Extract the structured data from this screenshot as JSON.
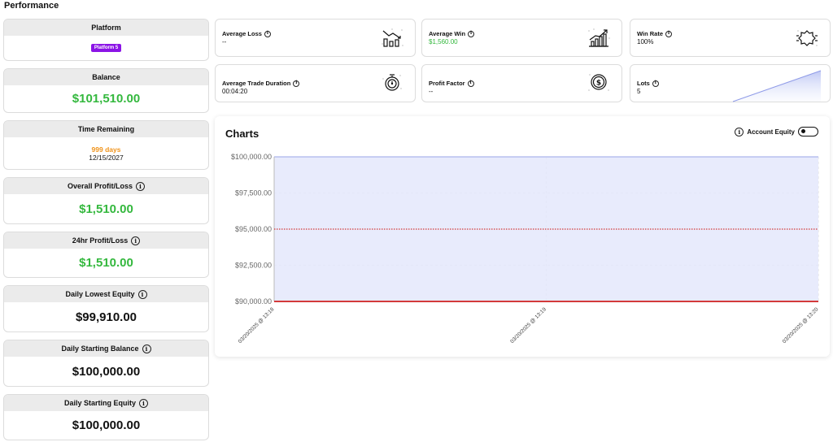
{
  "page": {
    "title": "Performance"
  },
  "sidebar": {
    "platform": {
      "label": "Platform",
      "badge": "Platform 5"
    },
    "balance": {
      "label": "Balance",
      "value": "$101,510.00"
    },
    "time_remaining": {
      "label": "Time Remaining",
      "days": "999 days",
      "date": "12/15/2027"
    },
    "overall_pl": {
      "label": "Overall Profit/Loss",
      "value": "$1,510.00"
    },
    "pl_24h": {
      "label": "24hr Profit/Loss",
      "value": "$1,510.00"
    },
    "daily_lowest_equity": {
      "label": "Daily Lowest Equity",
      "value": "$99,910.00"
    },
    "daily_starting_balance": {
      "label": "Daily Starting Balance",
      "value": "$100,000.00"
    },
    "daily_starting_equity": {
      "label": "Daily Starting Equity",
      "value": "$100,000.00"
    }
  },
  "stats": {
    "average_loss": {
      "label": "Average Loss",
      "value": "--",
      "icon": "chart-down-icon"
    },
    "average_win": {
      "label": "Average Win",
      "value": "$1,560.00",
      "icon": "chart-up-icon"
    },
    "win_rate": {
      "label": "Win Rate",
      "value": "100%",
      "icon": "badge-icon"
    },
    "average_trade_duration": {
      "label": "Average Trade Duration",
      "value": "00:04:20",
      "icon": "stopwatch-icon"
    },
    "profit_factor": {
      "label": "Profit Factor",
      "value": "--",
      "icon": "coin-icon"
    },
    "lots": {
      "label": "Lots",
      "value": "5"
    }
  },
  "colors": {
    "green": "#34b83e",
    "orange": "#f0941c",
    "purple": "#8b14e6",
    "red_line": "#d33a3a",
    "area_fill": "#e4e7fb"
  },
  "charts_panel": {
    "title": "Charts",
    "toggle_label": "Account Equity",
    "toggle_on": false
  },
  "chart_data": {
    "type": "area",
    "title": "Charts",
    "y_ticks": [
      "$90,000.00",
      "$92,500.00",
      "$95,000.00",
      "$97,500.00",
      "$100,000.00"
    ],
    "ylim": [
      90000,
      100000
    ],
    "x_ticks": [
      "03/20/2025 @ 13:18",
      "03/20/2025 @ 13:19",
      "03/20/2025 @ 13:20"
    ],
    "series": [
      {
        "values": [
          100000,
          100000,
          100000
        ]
      }
    ],
    "reference_lines": [
      {
        "value": 95000,
        "style": "dotted",
        "color": "#d33a3a"
      },
      {
        "value": 90000,
        "style": "solid",
        "color": "#d33a3a"
      }
    ],
    "grid": true
  }
}
